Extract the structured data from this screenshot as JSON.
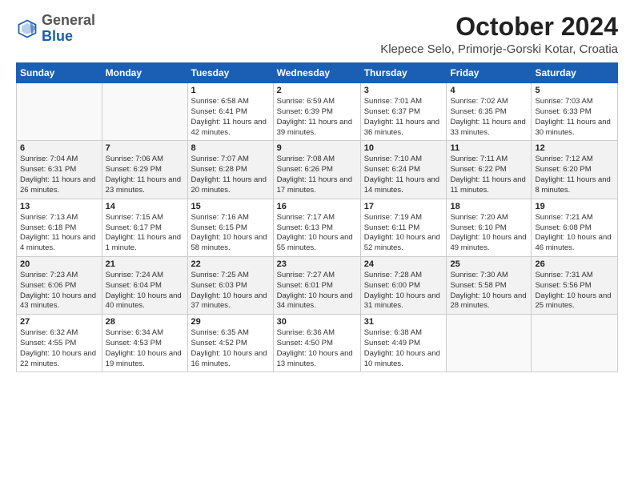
{
  "header": {
    "logo_general": "General",
    "logo_blue": "Blue",
    "month": "October 2024",
    "location": "Klepece Selo, Primorje-Gorski Kotar, Croatia"
  },
  "weekdays": [
    "Sunday",
    "Monday",
    "Tuesday",
    "Wednesday",
    "Thursday",
    "Friday",
    "Saturday"
  ],
  "weeks": [
    [
      {
        "day": "",
        "info": ""
      },
      {
        "day": "",
        "info": ""
      },
      {
        "day": "1",
        "info": "Sunrise: 6:58 AM\nSunset: 6:41 PM\nDaylight: 11 hours and 42 minutes."
      },
      {
        "day": "2",
        "info": "Sunrise: 6:59 AM\nSunset: 6:39 PM\nDaylight: 11 hours and 39 minutes."
      },
      {
        "day": "3",
        "info": "Sunrise: 7:01 AM\nSunset: 6:37 PM\nDaylight: 11 hours and 36 minutes."
      },
      {
        "day": "4",
        "info": "Sunrise: 7:02 AM\nSunset: 6:35 PM\nDaylight: 11 hours and 33 minutes."
      },
      {
        "day": "5",
        "info": "Sunrise: 7:03 AM\nSunset: 6:33 PM\nDaylight: 11 hours and 30 minutes."
      }
    ],
    [
      {
        "day": "6",
        "info": "Sunrise: 7:04 AM\nSunset: 6:31 PM\nDaylight: 11 hours and 26 minutes."
      },
      {
        "day": "7",
        "info": "Sunrise: 7:06 AM\nSunset: 6:29 PM\nDaylight: 11 hours and 23 minutes."
      },
      {
        "day": "8",
        "info": "Sunrise: 7:07 AM\nSunset: 6:28 PM\nDaylight: 11 hours and 20 minutes."
      },
      {
        "day": "9",
        "info": "Sunrise: 7:08 AM\nSunset: 6:26 PM\nDaylight: 11 hours and 17 minutes."
      },
      {
        "day": "10",
        "info": "Sunrise: 7:10 AM\nSunset: 6:24 PM\nDaylight: 11 hours and 14 minutes."
      },
      {
        "day": "11",
        "info": "Sunrise: 7:11 AM\nSunset: 6:22 PM\nDaylight: 11 hours and 11 minutes."
      },
      {
        "day": "12",
        "info": "Sunrise: 7:12 AM\nSunset: 6:20 PM\nDaylight: 11 hours and 8 minutes."
      }
    ],
    [
      {
        "day": "13",
        "info": "Sunrise: 7:13 AM\nSunset: 6:18 PM\nDaylight: 11 hours and 4 minutes."
      },
      {
        "day": "14",
        "info": "Sunrise: 7:15 AM\nSunset: 6:17 PM\nDaylight: 11 hours and 1 minute."
      },
      {
        "day": "15",
        "info": "Sunrise: 7:16 AM\nSunset: 6:15 PM\nDaylight: 10 hours and 58 minutes."
      },
      {
        "day": "16",
        "info": "Sunrise: 7:17 AM\nSunset: 6:13 PM\nDaylight: 10 hours and 55 minutes."
      },
      {
        "day": "17",
        "info": "Sunrise: 7:19 AM\nSunset: 6:11 PM\nDaylight: 10 hours and 52 minutes."
      },
      {
        "day": "18",
        "info": "Sunrise: 7:20 AM\nSunset: 6:10 PM\nDaylight: 10 hours and 49 minutes."
      },
      {
        "day": "19",
        "info": "Sunrise: 7:21 AM\nSunset: 6:08 PM\nDaylight: 10 hours and 46 minutes."
      }
    ],
    [
      {
        "day": "20",
        "info": "Sunrise: 7:23 AM\nSunset: 6:06 PM\nDaylight: 10 hours and 43 minutes."
      },
      {
        "day": "21",
        "info": "Sunrise: 7:24 AM\nSunset: 6:04 PM\nDaylight: 10 hours and 40 minutes."
      },
      {
        "day": "22",
        "info": "Sunrise: 7:25 AM\nSunset: 6:03 PM\nDaylight: 10 hours and 37 minutes."
      },
      {
        "day": "23",
        "info": "Sunrise: 7:27 AM\nSunset: 6:01 PM\nDaylight: 10 hours and 34 minutes."
      },
      {
        "day": "24",
        "info": "Sunrise: 7:28 AM\nSunset: 6:00 PM\nDaylight: 10 hours and 31 minutes."
      },
      {
        "day": "25",
        "info": "Sunrise: 7:30 AM\nSunset: 5:58 PM\nDaylight: 10 hours and 28 minutes."
      },
      {
        "day": "26",
        "info": "Sunrise: 7:31 AM\nSunset: 5:56 PM\nDaylight: 10 hours and 25 minutes."
      }
    ],
    [
      {
        "day": "27",
        "info": "Sunrise: 6:32 AM\nSunset: 4:55 PM\nDaylight: 10 hours and 22 minutes."
      },
      {
        "day": "28",
        "info": "Sunrise: 6:34 AM\nSunset: 4:53 PM\nDaylight: 10 hours and 19 minutes."
      },
      {
        "day": "29",
        "info": "Sunrise: 6:35 AM\nSunset: 4:52 PM\nDaylight: 10 hours and 16 minutes."
      },
      {
        "day": "30",
        "info": "Sunrise: 6:36 AM\nSunset: 4:50 PM\nDaylight: 10 hours and 13 minutes."
      },
      {
        "day": "31",
        "info": "Sunrise: 6:38 AM\nSunset: 4:49 PM\nDaylight: 10 hours and 10 minutes."
      },
      {
        "day": "",
        "info": ""
      },
      {
        "day": "",
        "info": ""
      }
    ]
  ]
}
